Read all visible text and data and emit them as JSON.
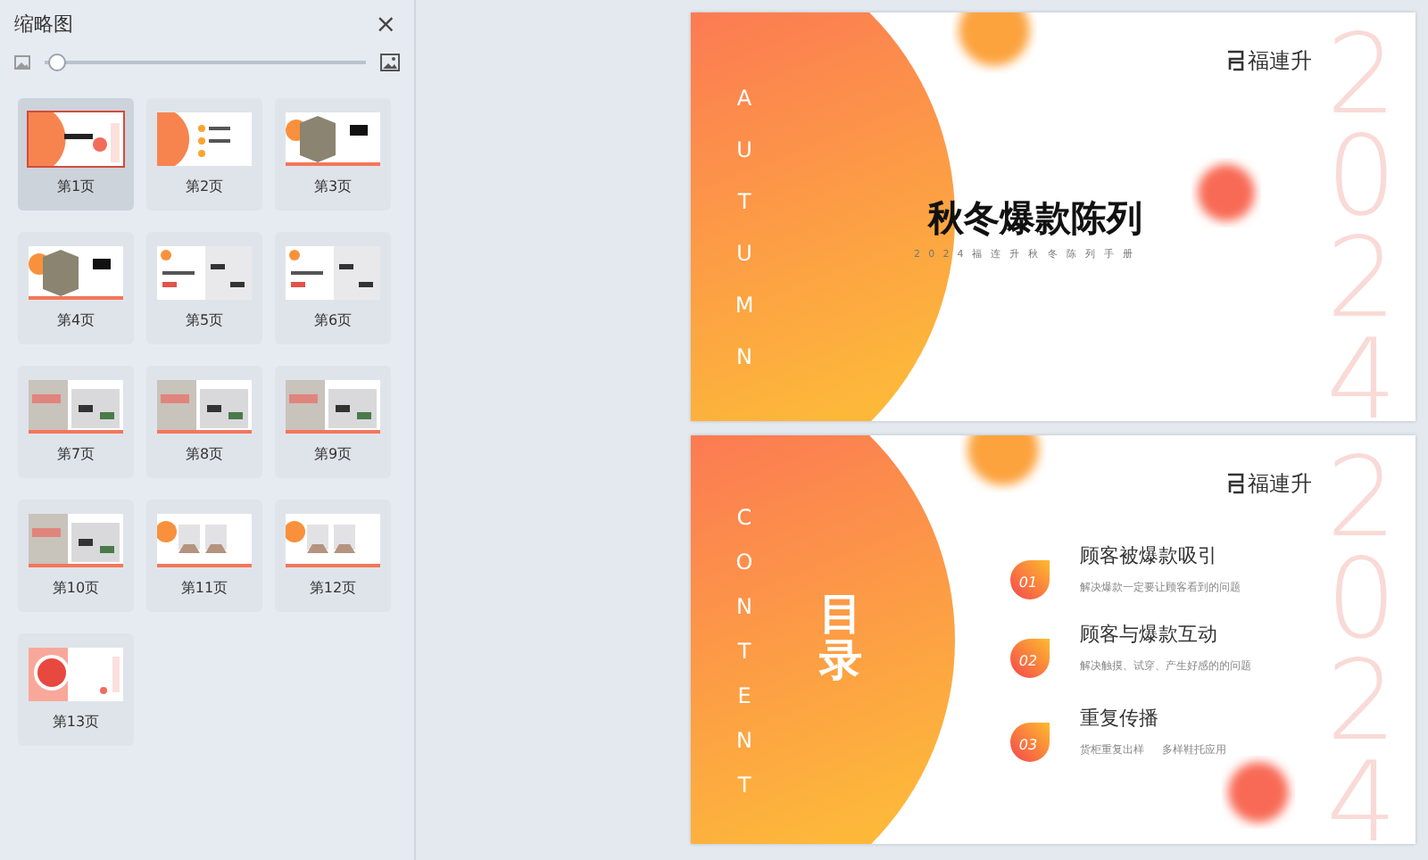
{
  "panel": {
    "title": "缩略图",
    "close": "×"
  },
  "zoom_slider": {
    "level": 0.01
  },
  "thumbnails": [
    {
      "label": "第1页",
      "selected": true
    },
    {
      "label": "第2页",
      "selected": false
    },
    {
      "label": "第3页",
      "selected": false
    },
    {
      "label": "第4页",
      "selected": false
    },
    {
      "label": "第5页",
      "selected": false
    },
    {
      "label": "第6页",
      "selected": false
    },
    {
      "label": "第7页",
      "selected": false
    },
    {
      "label": "第8页",
      "selected": false
    },
    {
      "label": "第9页",
      "selected": false
    },
    {
      "label": "第10页",
      "selected": false
    },
    {
      "label": "第11页",
      "selected": false
    },
    {
      "label": "第12页",
      "selected": false
    },
    {
      "label": "第13页",
      "selected": false
    }
  ],
  "slides": [
    {
      "kind": "cover",
      "vertical_word": "AUTUMN",
      "title": "秋冬爆款陈列",
      "subtitle": "2024福连升秋冬陈列手册",
      "brand": "福連升",
      "year": "2024"
    },
    {
      "kind": "contents",
      "vertical_word": "CONTENT",
      "heading": "目录",
      "brand": "福連升",
      "year": "2024",
      "items": [
        {
          "number": "01",
          "title": "顾客被爆款吸引",
          "descs": [
            "解决爆款一定要让顾客看到的问题"
          ]
        },
        {
          "number": "02",
          "title": "顾客与爆款互动",
          "descs": [
            "解决触摸、试穿、产生好感的的问题"
          ]
        },
        {
          "number": "03",
          "title": "重复传播",
          "descs": [
            "货柜重复出样",
            "多样鞋托应用"
          ]
        }
      ]
    }
  ]
}
